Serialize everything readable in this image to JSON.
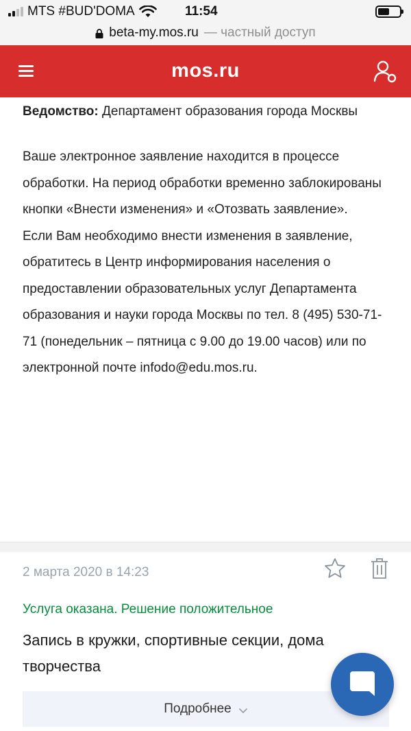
{
  "status_bar": {
    "carrier": "MTS #BUD'DOMA",
    "time": "11:54",
    "icons": [
      "signal-icon",
      "wifi-icon",
      "battery-icon"
    ]
  },
  "url_bar": {
    "domain": "beta-my.mos.ru",
    "note": "— частный доступ",
    "icon": "lock-icon"
  },
  "header": {
    "logo": "mos.ru",
    "menu_icon": "menu-icon",
    "user_icon": "user-icon",
    "background": "#d82d2d"
  },
  "department": {
    "label": "Ведомство:",
    "value": "Департамент образования города Москвы"
  },
  "message": {
    "text": "Ваше электронное заявление находится в процессе обработки. На период обработки временно заблокированы кнопки «Внести изменения» и «Отозвать заявление».\nЕсли Вам необходимо внести изменения в заявление, обратитесь в Центр информирования населения о предоставлении образовательных услуг Департамента образования и науки города Москвы по тел. 8 (495) 530-71-71 (понедельник – пятница с 9.00 до 19.00 часов) или по электронной почте  infodo@edu.mos.ru."
  },
  "application_item": {
    "date": "2 марта 2020 в 14:23",
    "status": "Услуга оказана. Решение положительное",
    "status_color": "#0a8a3c",
    "title": "Запись в кружки, спортивные секции, дома творчества",
    "more_label": "Подробнее",
    "icons": [
      "star-icon",
      "trash-icon",
      "chevron-down-icon"
    ]
  },
  "chat_button": {
    "icon": "chat-icon",
    "color": "#2a67b5"
  }
}
